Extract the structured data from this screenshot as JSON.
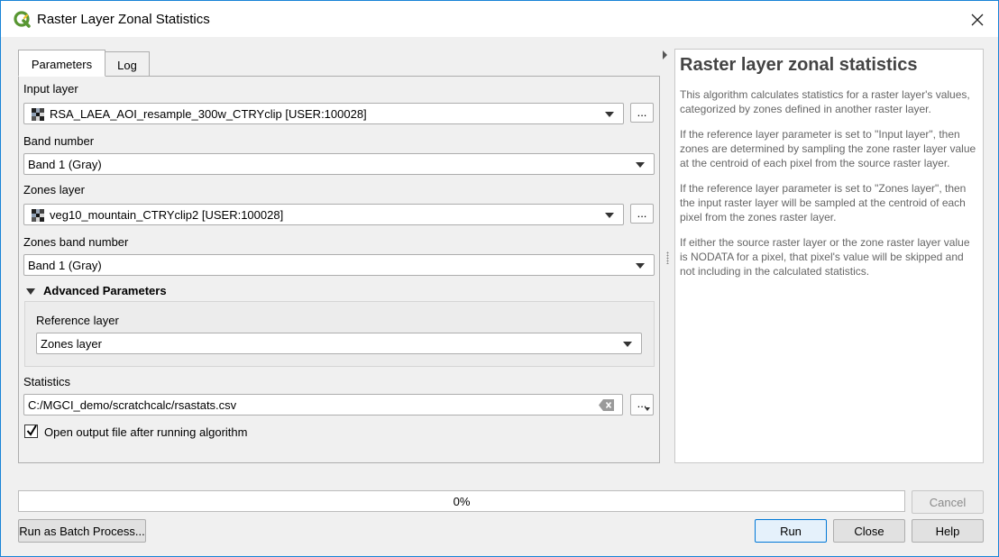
{
  "window": {
    "title": "Raster Layer Zonal Statistics",
    "close_glyph": "✕"
  },
  "tabs": [
    {
      "label": "Parameters",
      "active": true
    },
    {
      "label": "Log",
      "active": false
    }
  ],
  "params": {
    "input_layer": {
      "label": "Input layer",
      "value": "RSA_LAEA_AOI_resample_300w_CTRYclip [USER:100028]",
      "browse": "..."
    },
    "band_number": {
      "label": "Band number",
      "value": "Band 1 (Gray)"
    },
    "zones_layer": {
      "label": "Zones layer",
      "value": "veg10_mountain_CTRYclip2 [USER:100028]",
      "browse": "..."
    },
    "zones_band_number": {
      "label": "Zones band number",
      "value": "Band 1 (Gray)"
    },
    "advanced": {
      "header": "Advanced Parameters",
      "reference_layer": {
        "label": "Reference layer",
        "value": "Zones layer"
      }
    },
    "statistics": {
      "label": "Statistics",
      "value": "C:/MGCI_demo/scratchcalc/rsastats.csv",
      "browse": "..."
    },
    "open_output": {
      "label": "Open output file after running algorithm",
      "checked": true
    }
  },
  "help": {
    "title": "Raster layer zonal statistics",
    "paragraphs": [
      "This algorithm calculates statistics for a raster layer's values, categorized by zones defined in another raster layer.",
      "If the reference layer parameter is set to \"Input layer\", then zones are determined by sampling the zone raster layer value at the centroid of each pixel from the source raster layer.",
      "If the reference layer parameter is set to \"Zones layer\", then the input raster layer will be sampled at the centroid of each pixel from the zones raster layer.",
      "If either the source raster layer or the zone raster layer value is NODATA for a pixel, that pixel's value will be skipped and not including in the calculated statistics."
    ]
  },
  "progress": {
    "text": "0%",
    "value": 0
  },
  "buttons": {
    "cancel": "Cancel",
    "batch": "Run as Batch Process...",
    "run": "Run",
    "close": "Close",
    "help": "Help"
  },
  "colors": {
    "accent": "#0078d7",
    "qgis_green": "#589632",
    "progress": "#06b025"
  }
}
